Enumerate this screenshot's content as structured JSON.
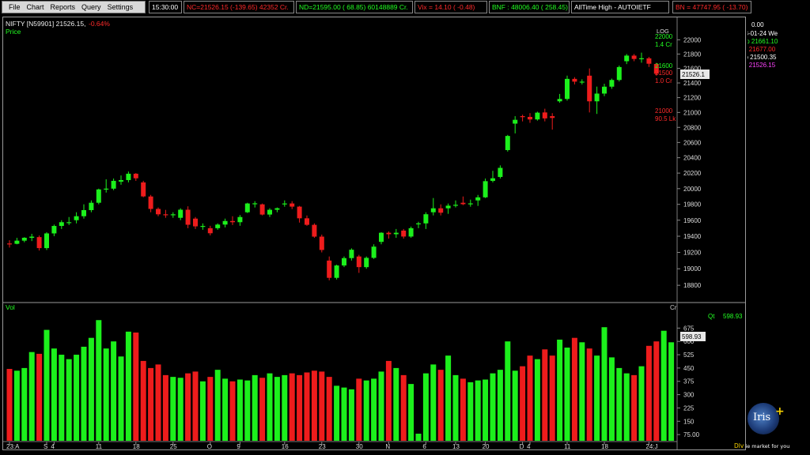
{
  "menu": [
    "File",
    "Chart",
    "Reports",
    "Query",
    "Settings"
  ],
  "ticker": {
    "time": "15:30:00",
    "nc": "NC=21526.15 (-139.65) 42352 Cr.",
    "nd": "ND=21595.00 ( 68.85) 60148889 Cr.",
    "vix": "Vix =  14.10 ( -0.48)",
    "bnf": "BNF : 48006.40 ( 258.45)",
    "ath": "AllTime High - AUTOIETF",
    "bn": "BN = 47747.95 ( -13.70)"
  },
  "header": {
    "symbol": "NIFTY [N59901] 21526.15,",
    "change": "-0.64%",
    "price_label": "Price",
    "log_label": "LOG",
    "vol_label": "Vol",
    "cr_label": "Cr"
  },
  "price_markers": {
    "m1_price": "22000",
    "m1_vol": "1.4 Cr",
    "m2_price": "21600",
    "m2_mid": "21500",
    "m2_vol": "1.0 Cr",
    "m3_price": "21000",
    "m3_vol": "90.5 Lk",
    "current": "21526.1",
    "current_vol": "598.93"
  },
  "ohlc_panel": {
    "value": "0.00",
    "date": "03-01-24 We",
    "open": "Op 21661.10",
    "high": "Hi  21677.00",
    "low": "Lo  21500.35",
    "close": "Cl  21526.15"
  },
  "volume_panel": {
    "qt_label": "Qt",
    "qt_value": "598.93"
  },
  "branding": {
    "logo_text": "Iris",
    "logo_plus": "+",
    "dlv": "Dlv",
    "tagline": "ie market for you"
  },
  "colors": {
    "up": "#1cf01c",
    "down": "#ee1c1c",
    "axis": "#9a9a9a",
    "open_label": "#22ff22",
    "high_label": "#ff2a2a",
    "close_label": "#ff44ff"
  },
  "chart_data": [
    {
      "type": "candlestick",
      "title": "NIFTY [N59901] 21526.15, -0.64%",
      "ylabel": "Price",
      "y_scale": "log",
      "ylim": [
        18650,
        22250
      ],
      "y_ticks": [
        18800,
        19000,
        19200,
        19400,
        19600,
        19800,
        20000,
        20200,
        20400,
        20600,
        20800,
        21000,
        21200,
        21400,
        21600,
        21800,
        22000
      ],
      "x_tick_labels": [
        "23:A",
        "S",
        "4",
        "11",
        "18",
        "25",
        "O",
        "9",
        "16",
        "23",
        "30",
        "N",
        "6",
        "13",
        "20",
        "D",
        "4",
        "11",
        "18",
        "24:J"
      ],
      "x_tick_index": [
        0,
        5,
        6,
        12,
        17,
        22,
        27,
        31,
        37,
        42,
        47,
        51,
        56,
        60,
        64,
        69,
        70,
        75,
        80,
        86
      ],
      "candles": [
        [
          19310,
          19350,
          19260,
          19306
        ],
        [
          19306,
          19380,
          19300,
          19345
        ],
        [
          19345,
          19388,
          19325,
          19381
        ],
        [
          19380,
          19430,
          19340,
          19395
        ],
        [
          19389,
          19409,
          19223,
          19253
        ],
        [
          19253,
          19450,
          19230,
          19435
        ],
        [
          19435,
          19545,
          19400,
          19528
        ],
        [
          19528,
          19600,
          19490,
          19575
        ],
        [
          19575,
          19640,
          19540,
          19575
        ],
        [
          19600,
          19700,
          19560,
          19650
        ],
        [
          19650,
          19800,
          19620,
          19727
        ],
        [
          19727,
          19850,
          19700,
          19820
        ],
        [
          19820,
          20000,
          19800,
          19990
        ],
        [
          19990,
          20120,
          19950,
          20000
        ],
        [
          20000,
          20130,
          19980,
          20100
        ],
        [
          20090,
          20170,
          20050,
          20110
        ],
        [
          20110,
          20220,
          20080,
          20192
        ],
        [
          20192,
          20200,
          20100,
          20133
        ],
        [
          20080,
          20100,
          19890,
          19901
        ],
        [
          19900,
          19920,
          19700,
          19742
        ],
        [
          19742,
          19760,
          19650,
          19674
        ],
        [
          19674,
          19730,
          19630,
          19665
        ],
        [
          19665,
          19700,
          19630,
          19674
        ],
        [
          19630,
          19750,
          19600,
          19732
        ],
        [
          19732,
          19775,
          19500,
          19543
        ],
        [
          19620,
          19640,
          19490,
          19523
        ],
        [
          19523,
          19560,
          19480,
          19528
        ],
        [
          19500,
          19530,
          19410,
          19437
        ],
        [
          19500,
          19560,
          19480,
          19545
        ],
        [
          19545,
          19620,
          19510,
          19590
        ],
        [
          19590,
          19650,
          19540,
          19575
        ],
        [
          19575,
          19665,
          19530,
          19640
        ],
        [
          19700,
          19820,
          19690,
          19811
        ],
        [
          19811,
          19840,
          19760,
          19813
        ],
        [
          19800,
          19810,
          19660,
          19671
        ],
        [
          19671,
          19750,
          19640,
          19731
        ],
        [
          19731,
          19760,
          19700,
          19751
        ],
        [
          19800,
          19850,
          19770,
          19811
        ],
        [
          19811,
          19840,
          19740,
          19771
        ],
        [
          19771,
          19780,
          19570,
          19624
        ],
        [
          19624,
          19660,
          19530,
          19542
        ],
        [
          19542,
          19560,
          19380,
          19395
        ],
        [
          19395,
          19420,
          19200,
          19230
        ],
        [
          19100,
          19150,
          18860,
          18890
        ],
        [
          18890,
          19050,
          18870,
          19040
        ],
        [
          19040,
          19150,
          19020,
          19130
        ],
        [
          19130,
          19250,
          19100,
          19233
        ],
        [
          19150,
          19170,
          18950,
          19020
        ],
        [
          19020,
          19150,
          19000,
          19133
        ],
        [
          19133,
          19300,
          19120,
          19271
        ],
        [
          19330,
          19450,
          19300,
          19443
        ],
        [
          19443,
          19460,
          19370,
          19425
        ],
        [
          19425,
          19490,
          19380,
          19443
        ],
        [
          19470,
          19490,
          19370,
          19396
        ],
        [
          19396,
          19520,
          19380,
          19500
        ],
        [
          19550,
          19580,
          19500,
          19560
        ],
        [
          19560,
          19700,
          19490,
          19675
        ],
        [
          19700,
          19880,
          19660,
          19750
        ],
        [
          19750,
          19800,
          19660,
          19694
        ],
        [
          19750,
          19810,
          19680,
          19783
        ],
        [
          19783,
          19850,
          19760,
          19794
        ],
        [
          19820,
          19900,
          19790,
          19802
        ],
        [
          19802,
          19860,
          19770,
          19812
        ],
        [
          19850,
          19920,
          19780,
          19889
        ],
        [
          19889,
          20130,
          19880,
          20096
        ],
        [
          20100,
          20230,
          20080,
          20133
        ],
        [
          20150,
          20300,
          20130,
          20268
        ],
        [
          20500,
          20700,
          20480,
          20686
        ],
        [
          20850,
          20950,
          20720,
          20901
        ],
        [
          20950,
          20970,
          20880,
          20937
        ],
        [
          20940,
          20990,
          20860,
          20906
        ],
        [
          20906,
          21010,
          20890,
          20997
        ],
        [
          21000,
          21050,
          20880,
          20920
        ],
        [
          20950,
          20990,
          20770,
          20926
        ],
        [
          21150,
          21250,
          21130,
          21182
        ],
        [
          21182,
          21500,
          21160,
          21456
        ],
        [
          21456,
          21480,
          21380,
          21418
        ],
        [
          21418,
          21450,
          21380,
          21418
        ],
        [
          21500,
          21600,
          21000,
          21150
        ],
        [
          21150,
          21350,
          20980,
          21255
        ],
        [
          21255,
          21390,
          21220,
          21349
        ],
        [
          21349,
          21460,
          21320,
          21441
        ],
        [
          21441,
          21640,
          21420,
          21619
        ],
        [
          21700,
          21800,
          21660,
          21778
        ],
        [
          21778,
          21800,
          21700,
          21731
        ],
        [
          21731,
          21820,
          21680,
          21741
        ],
        [
          21740,
          21760,
          21620,
          21665
        ],
        [
          21661.1,
          21677,
          21500.35,
          21526.15
        ]
      ]
    },
    {
      "type": "bar",
      "ylabel": "Vol",
      "unit": "Cr",
      "ylim": [
        40,
        770
      ],
      "y_ticks": [
        75.0,
        150,
        225,
        300,
        375,
        450,
        525,
        600,
        675
      ],
      "values": [
        445,
        435,
        450,
        540,
        530,
        665,
        560,
        525,
        500,
        525,
        570,
        620,
        720,
        560,
        600,
        515,
        655,
        650,
        490,
        450,
        470,
        410,
        400,
        395,
        420,
        430,
        375,
        400,
        440,
        390,
        375,
        385,
        380,
        410,
        395,
        420,
        400,
        410,
        420,
        410,
        425,
        435,
        430,
        400,
        350,
        340,
        330,
        390,
        380,
        390,
        430,
        490,
        450,
        410,
        360,
        80,
        420,
        470,
        440,
        520,
        410,
        390,
        370,
        380,
        385,
        420,
        440,
        600,
        435,
        460,
        520,
        500,
        555,
        520,
        610,
        565,
        620,
        595,
        560,
        520,
        680,
        510,
        450,
        420,
        410,
        460,
        575,
        600,
        660,
        595
      ]
    }
  ]
}
